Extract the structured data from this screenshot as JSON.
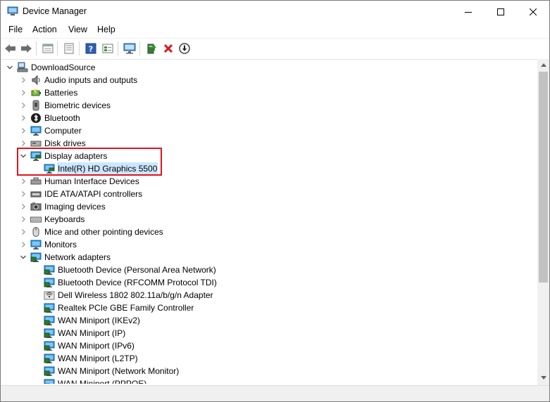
{
  "window": {
    "title": "Device Manager"
  },
  "menu": [
    {
      "label": "File"
    },
    {
      "label": "Action"
    },
    {
      "label": "View"
    },
    {
      "label": "Help"
    }
  ],
  "toolbar": [
    {
      "icon": "back-arrow-icon"
    },
    {
      "icon": "forward-arrow-icon"
    },
    {
      "icon": "properties-sheet-icon"
    },
    {
      "icon": "list-view-icon"
    },
    {
      "icon": "help-icon"
    },
    {
      "icon": "resource-view-icon"
    },
    {
      "icon": "monitor-scan-icon"
    },
    {
      "icon": "update-driver-icon"
    },
    {
      "icon": "uninstall-x-icon"
    },
    {
      "icon": "download-circle-icon"
    }
  ],
  "tree": {
    "root": {
      "label": "DownloadSource",
      "expanded": true
    },
    "items": [
      {
        "label": "Audio inputs and outputs",
        "icon": "speaker-icon",
        "level": 1,
        "expanded": false
      },
      {
        "label": "Batteries",
        "icon": "battery-icon",
        "level": 1,
        "expanded": false
      },
      {
        "label": "Biometric devices",
        "icon": "biometric-icon",
        "level": 1,
        "expanded": false
      },
      {
        "label": "Bluetooth",
        "icon": "bluetooth-icon",
        "level": 1,
        "expanded": false
      },
      {
        "label": "Computer",
        "icon": "computer-icon",
        "level": 1,
        "expanded": false
      },
      {
        "label": "Disk drives",
        "icon": "disk-drive-icon",
        "level": 1,
        "expanded": false
      },
      {
        "label": "Display adapters",
        "icon": "display-adapter-icon",
        "level": 1,
        "expanded": true
      },
      {
        "label": "Intel(R) HD Graphics 5500",
        "icon": "display-adapter-icon",
        "level": 2,
        "selected": true
      },
      {
        "label": "Human Interface Devices",
        "icon": "hid-icon",
        "level": 1,
        "expanded": false
      },
      {
        "label": "IDE ATA/ATAPI controllers",
        "icon": "ide-controller-icon",
        "level": 1,
        "expanded": false
      },
      {
        "label": "Imaging devices",
        "icon": "camera-icon",
        "level": 1,
        "expanded": false
      },
      {
        "label": "Keyboards",
        "icon": "keyboard-icon",
        "level": 1,
        "expanded": false
      },
      {
        "label": "Mice and other pointing devices",
        "icon": "mouse-icon",
        "level": 1,
        "expanded": false
      },
      {
        "label": "Monitors",
        "icon": "monitor-icon",
        "level": 1,
        "expanded": false
      },
      {
        "label": "Network adapters",
        "icon": "network-adapter-icon",
        "level": 1,
        "expanded": true
      },
      {
        "label": "Bluetooth Device (Personal Area Network)",
        "icon": "network-adapter-icon",
        "level": 2
      },
      {
        "label": "Bluetooth Device (RFCOMM Protocol TDI)",
        "icon": "network-adapter-icon",
        "level": 2
      },
      {
        "label": "Dell Wireless 1802 802.11a/b/g/n Adapter",
        "icon": "wireless-adapter-icon",
        "level": 2
      },
      {
        "label": "Realtek PCIe GBE Family Controller",
        "icon": "network-adapter-icon",
        "level": 2
      },
      {
        "label": "WAN Miniport (IKEv2)",
        "icon": "network-adapter-icon",
        "level": 2
      },
      {
        "label": "WAN Miniport (IP)",
        "icon": "network-adapter-icon",
        "level": 2
      },
      {
        "label": "WAN Miniport (IPv6)",
        "icon": "network-adapter-icon",
        "level": 2
      },
      {
        "label": "WAN Miniport (L2TP)",
        "icon": "network-adapter-icon",
        "level": 2
      },
      {
        "label": "WAN Miniport (Network Monitor)",
        "icon": "network-adapter-icon",
        "level": 2
      },
      {
        "label": "WAN Miniport (PPPOE)",
        "icon": "network-adapter-icon",
        "level": 2
      }
    ]
  },
  "colors": {
    "selection": "#cce8ff",
    "highlight_box": "#e0141e",
    "monitor_blue": "#1e90d8"
  }
}
